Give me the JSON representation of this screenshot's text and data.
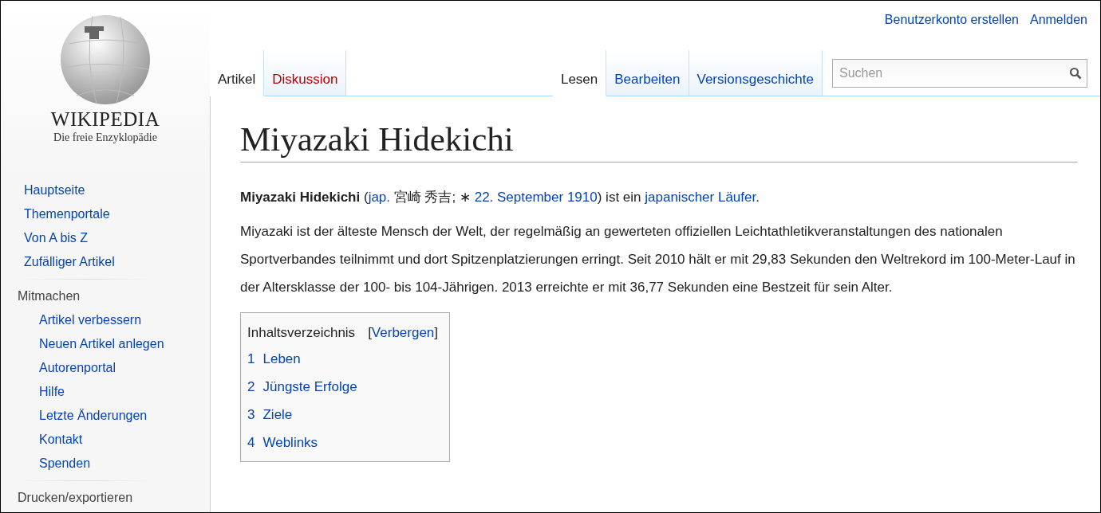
{
  "logo": {
    "wordmark": "WIKIPEDIA",
    "tagline": "Die freie Enzyklopädie"
  },
  "personal_links": [
    "Benutzerkonto erstellen",
    "Anmelden"
  ],
  "namespace_tabs": [
    {
      "label": "Artikel",
      "selected": true,
      "missing": false
    },
    {
      "label": "Diskussion",
      "selected": false,
      "missing": true
    }
  ],
  "view_tabs": [
    {
      "label": "Lesen",
      "selected": true
    },
    {
      "label": "Bearbeiten",
      "selected": false
    },
    {
      "label": "Versionsgeschichte",
      "selected": false
    }
  ],
  "search": {
    "placeholder": "Suchen"
  },
  "sidebar": {
    "items": [
      {
        "label": "Hauptseite"
      },
      {
        "label": "Themenportale"
      },
      {
        "label": "Von A bis Z"
      },
      {
        "label": "Zufälliger Artikel"
      }
    ],
    "portals": [
      {
        "heading": "Mitmachen",
        "children": [
          {
            "label": "Artikel verbessern"
          },
          {
            "label": "Neuen Artikel anlegen"
          },
          {
            "label": "Autorenportal"
          },
          {
            "label": "Hilfe"
          },
          {
            "label": "Letzte Änderungen"
          },
          {
            "label": "Kontakt"
          },
          {
            "label": "Spenden"
          }
        ]
      },
      {
        "heading": "Drucken/exportieren"
      }
    ]
  },
  "article": {
    "title": "Miyazaki Hidekichi",
    "intro": [
      {
        "kind": "bold",
        "text": "Miyazaki Hidekichi"
      },
      {
        "kind": "plain",
        "text": " ("
      },
      {
        "kind": "link",
        "text": "jap."
      },
      {
        "kind": "plain",
        "text": " 宮崎 秀吉; ∗ "
      },
      {
        "kind": "link",
        "text": "22. September 1910"
      },
      {
        "kind": "plain",
        "text": ") ist ein "
      },
      {
        "kind": "link",
        "text": "japanischer Läufer"
      },
      {
        "kind": "plain",
        "text": "."
      }
    ],
    "paragraph": "Miyazaki ist der älteste Mensch der Welt, der regelmäßig an gewerteten offiziellen Leichtathletikveranstaltungen des nationalen Sportverbandes teilnimmt und dort Spitzenplatzierungen erringt. Seit 2010 hält er mit 29,83 Sekunden den Weltrekord im 100-Meter-Lauf in der Altersklasse der 100- bis 104-Jährigen. 2013 erreichte er mit 36,77 Sekunden eine Bestzeit für sein Alter.",
    "toc": {
      "title": "Inhaltsverzeichnis",
      "toggle_open": "[",
      "toggle": "Verbergen",
      "toggle_close": "]",
      "entries": [
        {
          "number": "1",
          "label": "Leben"
        },
        {
          "number": "2",
          "label": "Jüngste Erfolge"
        },
        {
          "number": "3",
          "label": "Ziele"
        },
        {
          "number": "4",
          "label": "Weblinks"
        }
      ]
    }
  }
}
